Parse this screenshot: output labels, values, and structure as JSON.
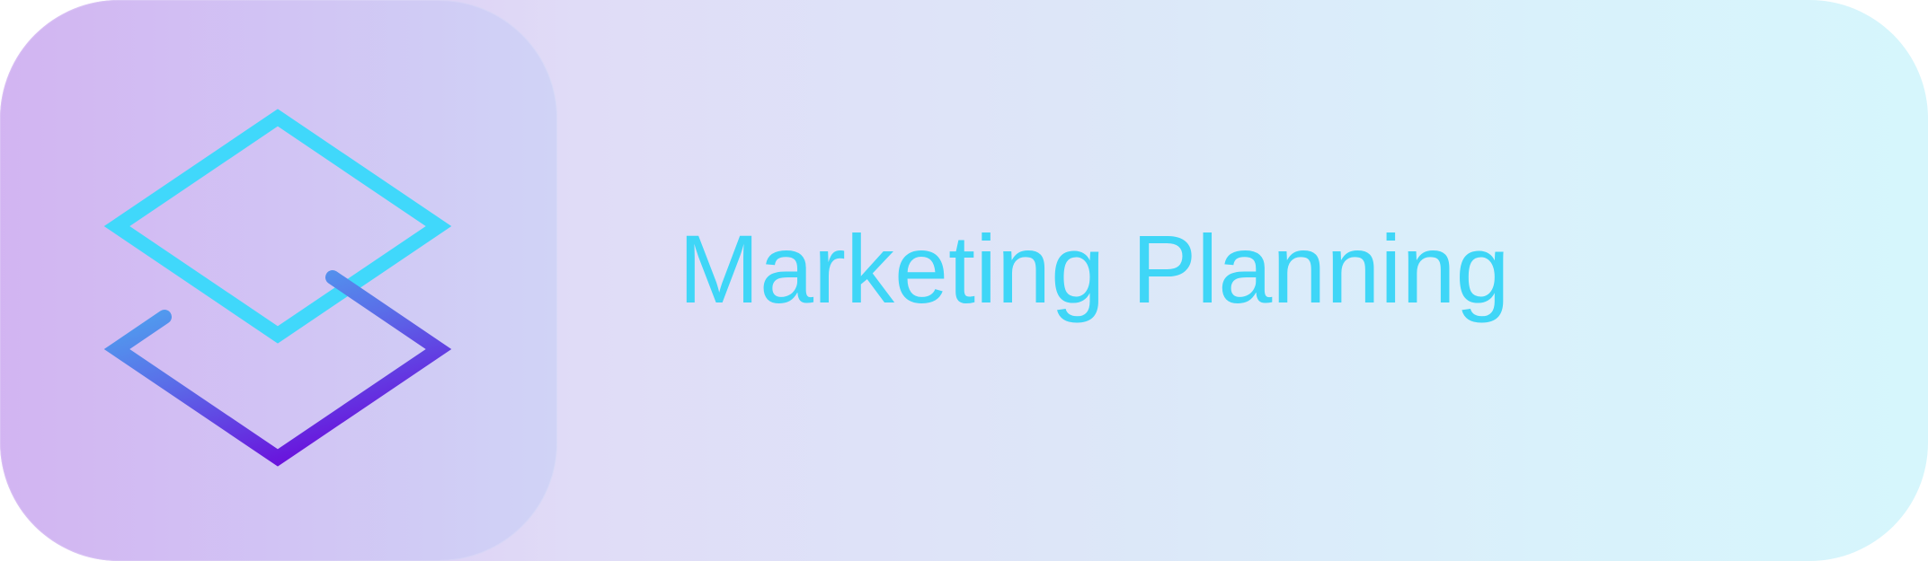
{
  "button": {
    "label": "Marketing Planning",
    "icon": "layers-icon"
  },
  "colors": {
    "label_text": "#3fd6f7",
    "icon_gradient_start": "#3fd6f7",
    "icon_gradient_end": "#6a12dc",
    "background_left": "#d8b8f0",
    "background_right": "#d6f6fc"
  }
}
